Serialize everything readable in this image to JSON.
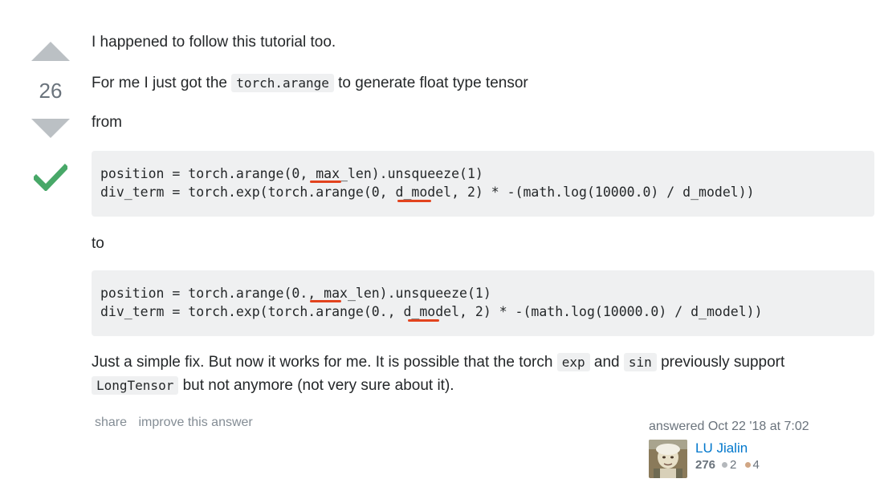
{
  "vote": {
    "count": "26",
    "accepted": true
  },
  "body": {
    "p1": "I happened to follow this tutorial too.",
    "p2_before": "For me I just got the ",
    "p2_code": "torch.arange",
    "p2_after": " to generate float type tensor",
    "p3": "from",
    "code_from": [
      "position = torch.arange(0, max_len).unsqueeze(1)",
      "div_term = torch.exp(torch.arange(0, d_model, 2) * -(math.log(10000.0) / d_model))"
    ],
    "p4": "to",
    "code_to": [
      "position = torch.arange(0., max_len).unsqueeze(1)",
      "div_term = torch.exp(torch.arange(0., d_model, 2) * -(math.log(10000.0) / d_model))"
    ],
    "p5_a": "Just a simple fix. But now it works for me. It is possible that the torch ",
    "p5_code1": "exp",
    "p5_b": " and ",
    "p5_code2": "sin",
    "p5_c": " previously support ",
    "p5_code3": "LongTensor",
    "p5_d": " but not anymore (not very sure about it)."
  },
  "menu": {
    "share": "share",
    "improve": "improve this answer"
  },
  "signature": {
    "answered": "answered Oct 22 '18 at 7:02",
    "user_name": "LU Jialin",
    "reputation": "276",
    "silver": "2",
    "bronze": "4"
  },
  "colors": {
    "accepted": "#48a868",
    "link": "#0077cc",
    "annotation": "#e2431e"
  }
}
